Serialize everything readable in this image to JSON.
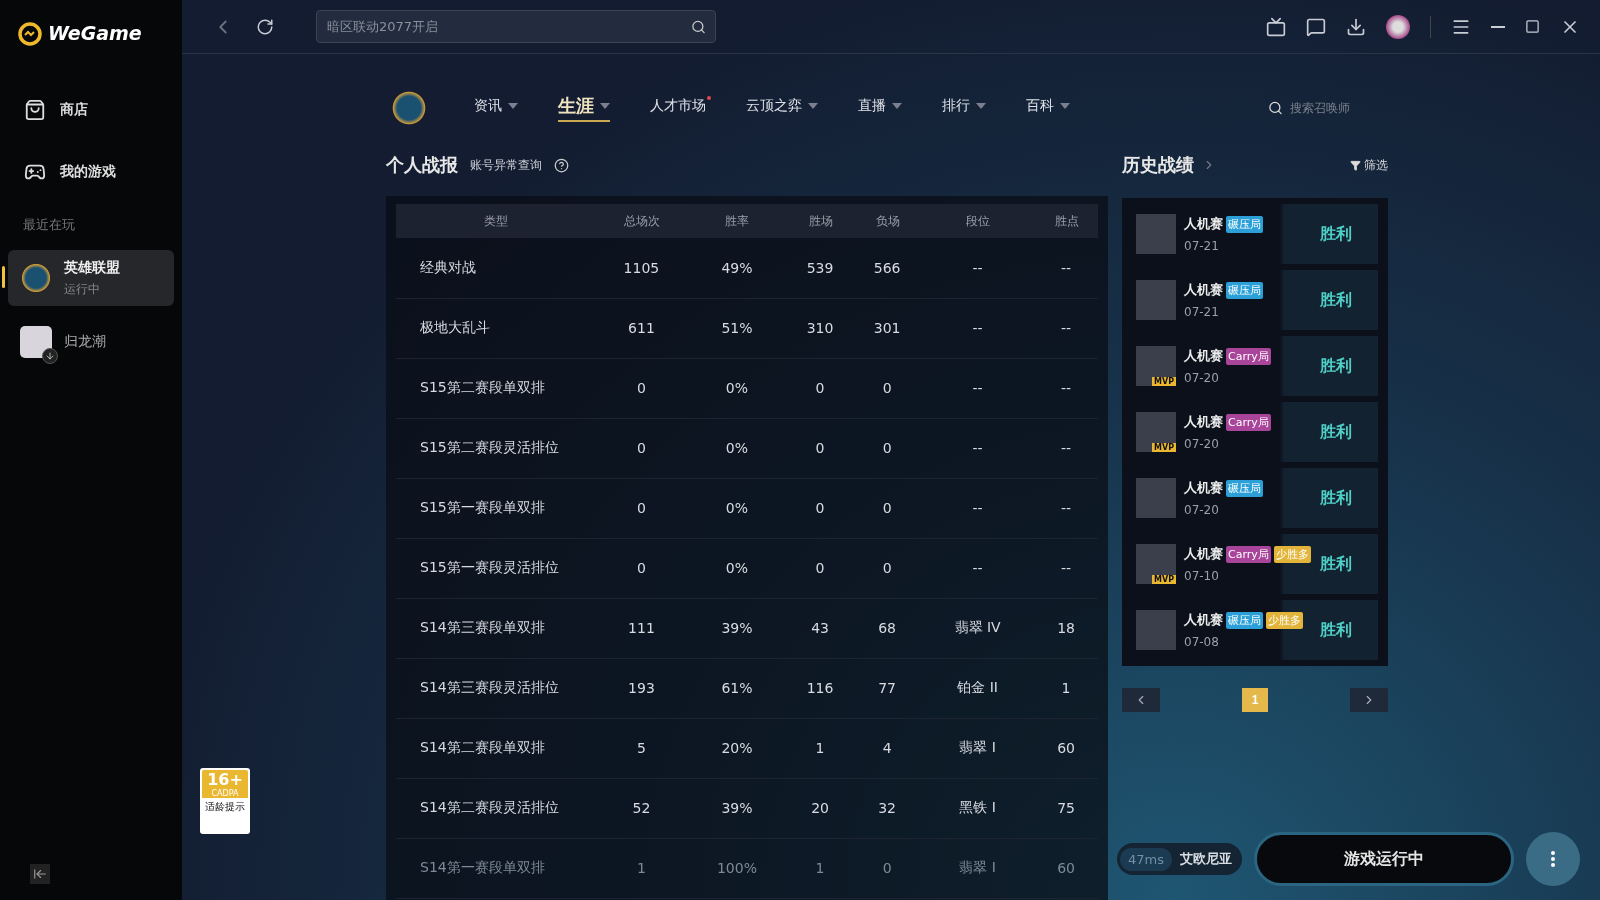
{
  "app": {
    "logo": "WeGame"
  },
  "sidebar": {
    "items": [
      {
        "label": "商店",
        "kind": "store",
        "selected": false
      },
      {
        "label": "我的游戏",
        "kind": "games",
        "selected": false
      }
    ],
    "recent_title": "最近在玩",
    "recent": [
      {
        "name": "英雄联盟",
        "status": "运行中",
        "selected": true,
        "downloading": false
      },
      {
        "name": "归龙潮",
        "selected": false,
        "downloading": true
      }
    ]
  },
  "search": {
    "placeholder": "暗区联动2077开启"
  },
  "nav": [
    {
      "label": "资讯",
      "dropdown": true,
      "selected": false,
      "dot": false
    },
    {
      "label": "生涯",
      "dropdown": true,
      "selected": true,
      "dot": false
    },
    {
      "label": "人才市场",
      "dropdown": false,
      "selected": false,
      "dot": true
    },
    {
      "label": "云顶之弈",
      "dropdown": true,
      "selected": false,
      "dot": false
    },
    {
      "label": "直播",
      "dropdown": true,
      "selected": false,
      "dot": false
    },
    {
      "label": "排行",
      "dropdown": true,
      "selected": false,
      "dot": false
    },
    {
      "label": "百科",
      "dropdown": true,
      "selected": false,
      "dot": false
    }
  ],
  "summoner_search": {
    "placeholder": "搜索召唤师"
  },
  "stats": {
    "title": "个人战报",
    "link": "账号异常查询",
    "columns": [
      "类型",
      "总场次",
      "胜率",
      "胜场",
      "负场",
      "段位",
      "胜点"
    ],
    "rows": [
      [
        "经典对战",
        "1105",
        "49%",
        "539",
        "566",
        "--",
        "--"
      ],
      [
        "极地大乱斗",
        "611",
        "51%",
        "310",
        "301",
        "--",
        "--"
      ],
      [
        "S15第二赛段单双排",
        "0",
        "0%",
        "0",
        "0",
        "--",
        "--"
      ],
      [
        "S15第二赛段灵活排位",
        "0",
        "0%",
        "0",
        "0",
        "--",
        "--"
      ],
      [
        "S15第一赛段单双排",
        "0",
        "0%",
        "0",
        "0",
        "--",
        "--"
      ],
      [
        "S15第一赛段灵活排位",
        "0",
        "0%",
        "0",
        "0",
        "--",
        "--"
      ],
      [
        "S14第三赛段单双排",
        "111",
        "39%",
        "43",
        "68",
        "翡翠 IV",
        "18"
      ],
      [
        "S14第三赛段灵活排位",
        "193",
        "61%",
        "116",
        "77",
        "铂金 II",
        "1"
      ],
      [
        "S14第二赛段单双排",
        "5",
        "20%",
        "1",
        "4",
        "翡翠 I",
        "60"
      ],
      [
        "S14第二赛段灵活排位",
        "52",
        "39%",
        "20",
        "32",
        "黑铁 I",
        "75"
      ],
      [
        "S14第一赛段单双排",
        "1",
        "100%",
        "1",
        "0",
        "翡翠 I",
        "60"
      ]
    ]
  },
  "history": {
    "title": "历史战绩",
    "filter": "筛选",
    "matches": [
      {
        "mode": "人机赛",
        "tags": [
          {
            "label": "碾压局",
            "color": "#2a9fd8"
          }
        ],
        "date": "07-21",
        "result": "胜利"
      },
      {
        "mode": "人机赛",
        "tags": [
          {
            "label": "碾压局",
            "color": "#2a9fd8"
          }
        ],
        "date": "07-21",
        "result": "胜利"
      },
      {
        "mode": "人机赛",
        "tags": [
          {
            "label": "Carry局",
            "color": "#a8449a"
          }
        ],
        "date": "07-20",
        "result": "胜利",
        "mvp": "MVP"
      },
      {
        "mode": "人机赛",
        "tags": [
          {
            "label": "Carry局",
            "color": "#a8449a"
          }
        ],
        "date": "07-20",
        "result": "胜利",
        "mvp": "MVP"
      },
      {
        "mode": "人机赛",
        "tags": [
          {
            "label": "碾压局",
            "color": "#2a9fd8"
          }
        ],
        "date": "07-20",
        "result": "胜利"
      },
      {
        "mode": "人机赛",
        "tags": [
          {
            "label": "Carry局",
            "color": "#a8449a"
          },
          {
            "label": "少胜多",
            "color": "#e2b53a"
          }
        ],
        "date": "07-10",
        "result": "胜利",
        "mvp": "MVP"
      },
      {
        "mode": "人机赛",
        "tags": [
          {
            "label": "碾压局",
            "color": "#2a9fd8"
          },
          {
            "label": "少胜多",
            "color": "#e2b53a"
          }
        ],
        "date": "07-08",
        "result": "胜利"
      }
    ],
    "pages": [
      {
        "label": "1",
        "selected": true
      }
    ]
  },
  "age_rating": {
    "age": "16+",
    "org": "CADPA",
    "caption": "适龄提示"
  },
  "footer": {
    "ping": "47ms",
    "server": "艾欧尼亚",
    "launch": "游戏运行中"
  }
}
